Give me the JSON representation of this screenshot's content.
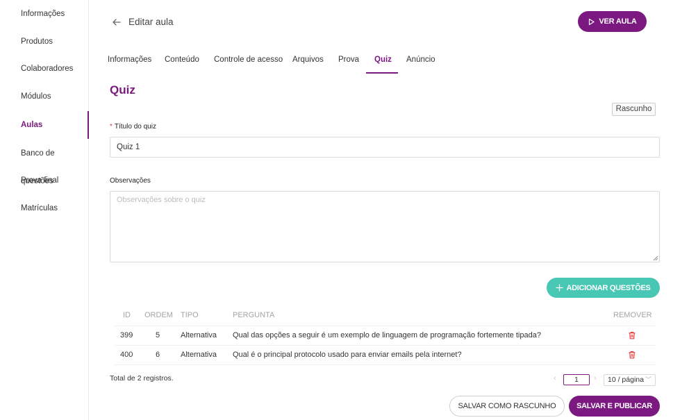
{
  "sidebar": {
    "items": [
      {
        "label": "Informações"
      },
      {
        "label": "Produtos"
      },
      {
        "label": "Colaboradores"
      },
      {
        "label": "Módulos"
      },
      {
        "label": "Aulas",
        "active": true
      },
      {
        "label": "Banco de questões"
      },
      {
        "label": "Prova final"
      },
      {
        "label": "Matrículas"
      }
    ]
  },
  "header": {
    "title": "Editar aula",
    "view_button": "VER AULA"
  },
  "tabs": [
    {
      "label": "Informações"
    },
    {
      "label": "Conteúdo"
    },
    {
      "label": "Controle de acesso"
    },
    {
      "label": "Arquivos"
    },
    {
      "label": "Prova"
    },
    {
      "label": "Quiz",
      "active": true
    },
    {
      "label": "Anúncio"
    }
  ],
  "section": {
    "title": "Quiz",
    "status": "Rascunho"
  },
  "form": {
    "title_label": "Título do quiz",
    "title_value": "Quiz 1",
    "notes_label": "Observações",
    "notes_placeholder": "Observações sobre o quiz"
  },
  "add_button": "ADICIONAR QUESTÕES",
  "table": {
    "columns": [
      "ID",
      "ORDEM",
      "TIPO",
      "PERGUNTA",
      "REMOVER"
    ],
    "rows": [
      {
        "id": "399",
        "order": "5",
        "type": "Alternativa",
        "question": "Qual das opções a seguir é um exemplo de linguagem de programação fortemente tipada?"
      },
      {
        "id": "400",
        "order": "6",
        "type": "Alternativa",
        "question": "Qual é o principal protocolo usado para enviar emails pela internet?"
      }
    ]
  },
  "pagination": {
    "total_prefix": "Total de ",
    "total_count": "2",
    "total_suffix": " registros.",
    "current_page": "1",
    "page_size": "10 / página"
  },
  "actions": {
    "save_draft": "SALVAR COMO RASCUNHO",
    "save_publish": "SALVAR E PUBLICAR"
  },
  "colors": {
    "primary": "#7b1980",
    "accent": "#47c7b4",
    "danger": "#e53935"
  }
}
